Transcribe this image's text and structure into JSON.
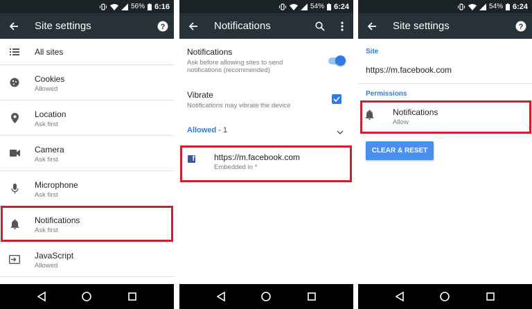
{
  "status": {
    "p1": {
      "battery": "56%",
      "time": "6:16"
    },
    "p2": {
      "battery": "54%",
      "time": "6:24"
    },
    "p3": {
      "battery": "54%",
      "time": "6:24"
    }
  },
  "panel1": {
    "title": "Site settings",
    "items": [
      {
        "label": "All sites",
        "icon": "list-icon"
      },
      {
        "label": "Cookies",
        "sub": "Allowed",
        "icon": "cookie-icon"
      },
      {
        "label": "Location",
        "sub": "Ask first",
        "icon": "location-pin-icon"
      },
      {
        "label": "Camera",
        "sub": "Ask first",
        "icon": "camera-icon"
      },
      {
        "label": "Microphone",
        "sub": "Ask first",
        "icon": "microphone-icon"
      },
      {
        "label": "Notifications",
        "sub": "Ask first",
        "icon": "bell-icon"
      },
      {
        "label": "JavaScript",
        "sub": "Allowed",
        "icon": "javascript-icon"
      }
    ]
  },
  "panel2": {
    "title": "Notifications",
    "notifications": {
      "label": "Notifications",
      "desc": "Ask before allowing sites to send notifications (recommended)",
      "enabled": true
    },
    "vibrate": {
      "label": "Vibrate",
      "desc": "Notifications may vibrate the device",
      "checked": true
    },
    "allowed": {
      "label": "Allowed",
      "count": " - 1"
    },
    "site": {
      "url": "https://m.facebook.com",
      "sub": "Embedded in *",
      "icon_letter": "f"
    }
  },
  "panel3": {
    "title": "Site settings",
    "site_label": "Site",
    "site_url": "https://m.facebook.com",
    "permissions_label": "Permissions",
    "permission": {
      "label": "Notifications",
      "sub": "Allow"
    },
    "clear_button": "CLEAR & RESET"
  },
  "colors": {
    "statusbar": "#1b2327",
    "appbar": "#263238",
    "accent": "#2f7ae5",
    "highlight": "#d0202e",
    "facebook": "#3b5998"
  }
}
